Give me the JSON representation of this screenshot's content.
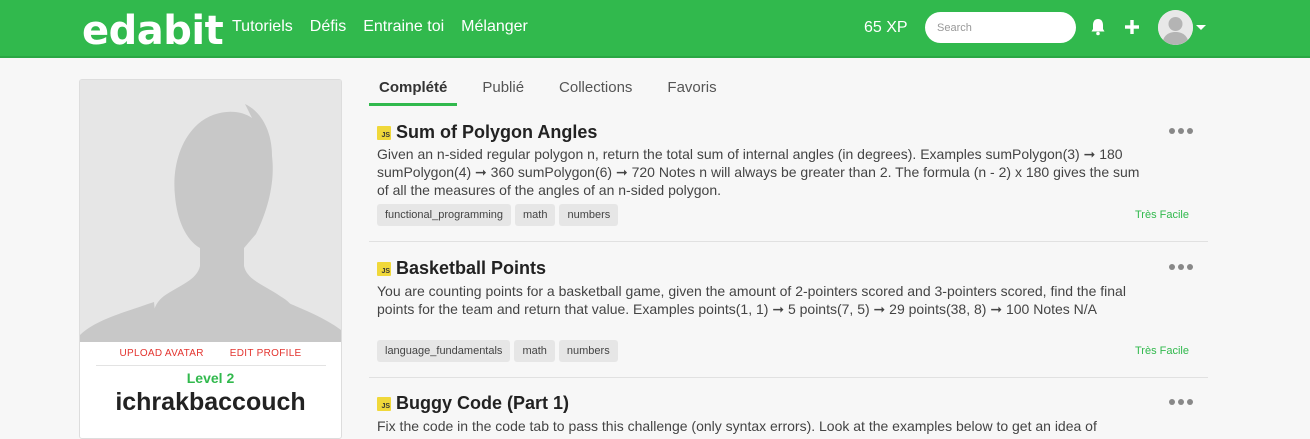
{
  "navbar": {
    "logo": "edabit",
    "links": [
      "Tutoriels",
      "Défis",
      "Entraine toi",
      "Mélanger"
    ],
    "xp": "65 XP",
    "search_placeholder": "Search",
    "icons": [
      "bell-icon",
      "plus-icon",
      "avatar",
      "caret-down-icon"
    ],
    "colors": {
      "brand": "#31b94d",
      "accent_red": "#e3342f"
    }
  },
  "profile": {
    "upload_avatar": "UPLOAD AVATAR",
    "edit_profile": "EDIT PROFILE",
    "level": "Level 2",
    "username": "ichrakbaccouch"
  },
  "tabs": [
    {
      "label": "Complété",
      "active": true
    },
    {
      "label": "Publié",
      "active": false
    },
    {
      "label": "Collections",
      "active": false
    },
    {
      "label": "Favoris",
      "active": false
    }
  ],
  "challenges": [
    {
      "language": "JS",
      "title": "Sum of Polygon Angles",
      "description": "Given an n-sided regular polygon n, return the total sum of internal angles (in degrees). Examples sumPolygon(3) ➞ 180 sumPolygon(4) ➞ 360 sumPolygon(6) ➞ 720 Notes n will always be greater than 2. The formula (n - 2) x 180 gives the sum of all the measures of the angles of an n-sided polygon.",
      "tags": [
        "functional_programming",
        "math",
        "numbers"
      ],
      "difficulty": "Très Facile"
    },
    {
      "language": "JS",
      "title": "Basketball Points",
      "description": "You are counting points for a basketball game, given the amount of 2-pointers scored and 3-pointers scored, find the final points for the team and return that value. Examples points(1, 1) ➞ 5 points(7, 5) ➞ 29 points(38, 8) ➞ 100 Notes N/A",
      "tags": [
        "language_fundamentals",
        "math",
        "numbers"
      ],
      "difficulty": "Très Facile"
    },
    {
      "language": "JS",
      "title": "Buggy Code (Part 1)",
      "description": "Fix the code in the code tab to pass this challenge (only syntax errors). Look at the examples below to get an idea of",
      "tags": [],
      "difficulty": ""
    }
  ]
}
